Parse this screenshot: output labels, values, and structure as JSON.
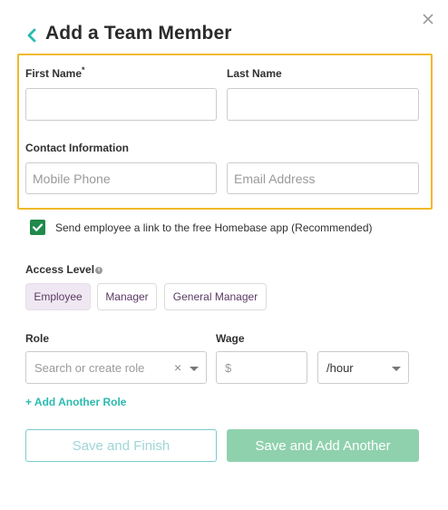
{
  "header": {
    "title": "Add a Team Member"
  },
  "form": {
    "first_name_label": "First Name",
    "required_mark": "*",
    "last_name_label": "Last Name",
    "first_name_value": "",
    "last_name_value": "",
    "contact_label": "Contact Information",
    "mobile_placeholder": "Mobile Phone",
    "email_placeholder": "Email Address",
    "highlight_color": "#f0b92b"
  },
  "app_link": {
    "checked": true,
    "label": "Send employee a link to the free Homebase app (Recommended)",
    "color": "#1f8a4c"
  },
  "access": {
    "label": "Access Level",
    "info_icon": "i",
    "options": [
      "Employee",
      "Manager",
      "General Manager"
    ],
    "selected": "Employee"
  },
  "role": {
    "label": "Role",
    "placeholder": "Search or create role",
    "clear_symbol": "×"
  },
  "wage": {
    "label": "Wage",
    "currency_placeholder": "$",
    "period": "/hour"
  },
  "add_role_link": "+ Add Another Role",
  "buttons": {
    "save_finish": "Save and Finish",
    "save_add": "Save and Add Another"
  },
  "colors": {
    "teal": "#2cbab0",
    "green_button": "#8fd1ad",
    "purple_text": "#5c3a63"
  }
}
